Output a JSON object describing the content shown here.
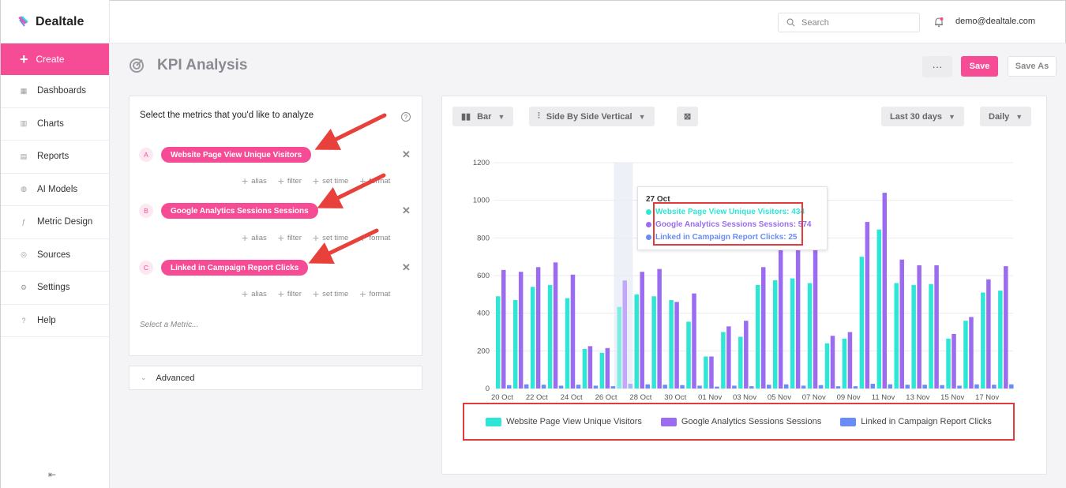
{
  "app": {
    "name": "Dealtale",
    "user_email": "demo@dealtale.com",
    "search_placeholder": "Search"
  },
  "sidebar": {
    "create_label": "Create",
    "items": [
      {
        "label": "Dashboards",
        "icon": "grid-icon"
      },
      {
        "label": "Charts",
        "icon": "chart-icon"
      },
      {
        "label": "Reports",
        "icon": "document-icon"
      },
      {
        "label": "AI Models",
        "icon": "ai-icon"
      },
      {
        "label": "Metric Design",
        "icon": "function-icon"
      },
      {
        "label": "Sources",
        "icon": "database-icon"
      },
      {
        "label": "Settings",
        "icon": "gear-icon"
      },
      {
        "label": "Help",
        "icon": "help-icon"
      }
    ]
  },
  "header": {
    "title": "KPI Analysis",
    "more_label": "···",
    "save_label": "Save",
    "save_as_label": "Save As"
  },
  "metrics": {
    "heading": "Select the metrics that you'd like to analyze",
    "items": [
      {
        "letter": "A",
        "name": "Website Page View Unique Visitors"
      },
      {
        "letter": "B",
        "name": "Google Analytics Sessions Sessions"
      },
      {
        "letter": "C",
        "name": "Linked in Campaign Report Clicks"
      }
    ],
    "options": [
      "alias",
      "filter",
      "set time",
      "format"
    ],
    "select_placeholder": "Select a Metric...",
    "advanced_label": "Advanced"
  },
  "chart_controls": {
    "type_label": "Bar",
    "layout_label": "Side By Side Vertical",
    "range_label": "Last 30 days",
    "granularity_label": "Daily"
  },
  "tooltip": {
    "date": "27 Oct",
    "rows": [
      {
        "text": "Website Page View Unique Visitors: 434",
        "color": "#2ee6d6"
      },
      {
        "text": "Google Analytics Sessions Sessions: 574",
        "color": "#9b6cf0"
      },
      {
        "text": "Linked in Campaign Report Clicks: 25",
        "color": "#6a8cf5"
      }
    ]
  },
  "chart_data": {
    "type": "bar",
    "categories": [
      "20 Oct",
      "21 Oct",
      "22 Oct",
      "23 Oct",
      "24 Oct",
      "25 Oct",
      "26 Oct",
      "27 Oct",
      "28 Oct",
      "29 Oct",
      "30 Oct",
      "31 Oct",
      "01 Nov",
      "02 Nov",
      "03 Nov",
      "04 Nov",
      "05 Nov",
      "06 Nov",
      "07 Nov",
      "08 Nov",
      "09 Nov",
      "10 Nov",
      "11 Nov",
      "12 Nov",
      "13 Nov",
      "14 Nov",
      "15 Nov",
      "16 Nov",
      "17 Nov",
      "18 Nov"
    ],
    "x_tick_labels": [
      "20 Oct",
      "22 Oct",
      "24 Oct",
      "26 Oct",
      "28 Oct",
      "30 Oct",
      "01 Nov",
      "03 Nov",
      "05 Nov",
      "07 Nov",
      "09 Nov",
      "11 Nov",
      "13 Nov",
      "15 Nov",
      "17 Nov"
    ],
    "highlight_category": "27 Oct",
    "ylim": [
      0,
      1200
    ],
    "yticks": [
      0,
      200,
      400,
      600,
      800,
      1000,
      1200
    ],
    "grid": true,
    "legend_position": "bottom",
    "series": [
      {
        "name": "Website Page View Unique Visitors",
        "color": "#2ee6d6",
        "values": [
          490,
          470,
          540,
          550,
          480,
          210,
          190,
          434,
          500,
          490,
          470,
          355,
          170,
          300,
          275,
          550,
          575,
          585,
          560,
          240,
          265,
          700,
          845,
          560,
          550,
          555,
          265,
          360,
          510,
          520
        ]
      },
      {
        "name": "Google Analytics Sessions Sessions",
        "color": "#9b6cf0",
        "values": [
          630,
          620,
          645,
          670,
          605,
          225,
          215,
          574,
          620,
          635,
          460,
          505,
          170,
          330,
          360,
          645,
          740,
          735,
          735,
          280,
          300,
          885,
          1040,
          685,
          655,
          655,
          290,
          380,
          580,
          650
        ]
      },
      {
        "name": "Linked in Campaign Report Clicks",
        "color": "#6a8cf5",
        "values": [
          18,
          22,
          20,
          15,
          20,
          15,
          12,
          25,
          22,
          20,
          18,
          15,
          10,
          15,
          12,
          20,
          22,
          15,
          18,
          12,
          12,
          25,
          22,
          20,
          20,
          18,
          15,
          22,
          20,
          22
        ]
      }
    ]
  }
}
